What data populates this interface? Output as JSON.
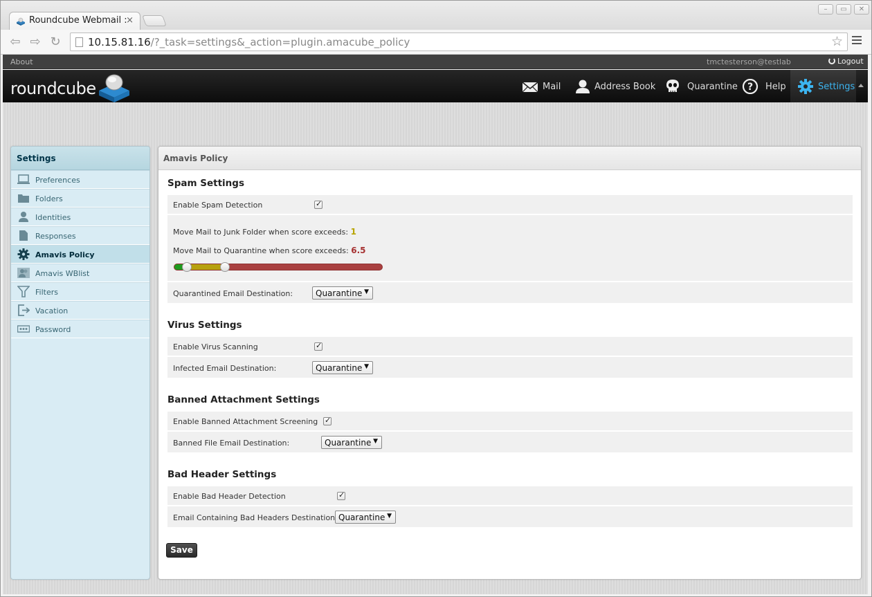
{
  "browser": {
    "tab_title": "Roundcube Webmail :",
    "tab_close": "×",
    "url_host": "10.15.81.16",
    "url_path": "/?_task=settings&_action=plugin.amacube_policy",
    "star": "☆"
  },
  "topline": {
    "about": "About",
    "user": "tmctesterson@testlab",
    "logout": "Logout"
  },
  "logo": {
    "text": "roundcube"
  },
  "nav": {
    "mail": "Mail",
    "addressbook": "Address Book",
    "quarantine": "Quarantine",
    "help": "Help",
    "settings": "Settings"
  },
  "sidebar": {
    "title": "Settings",
    "items": [
      {
        "label": "Preferences",
        "icon": "monitor-icon"
      },
      {
        "label": "Folders",
        "icon": "folder-icon"
      },
      {
        "label": "Identities",
        "icon": "person-icon"
      },
      {
        "label": "Responses",
        "icon": "document-icon"
      },
      {
        "label": "Amavis Policy",
        "icon": "gear-icon"
      },
      {
        "label": "Amavis WBlist",
        "icon": "users-icon"
      },
      {
        "label": "Filters",
        "icon": "filter-icon"
      },
      {
        "label": "Vacation",
        "icon": "exit-icon"
      },
      {
        "label": "Password",
        "icon": "password-icon"
      }
    ]
  },
  "content": {
    "title": "Amavis Policy",
    "spam": {
      "heading": "Spam Settings",
      "enable_label": "Enable Spam Detection",
      "enable_checked": true,
      "junk_label": "Move Mail to Junk Folder when score exceeds:",
      "junk_value": "1",
      "quarantine_label": "Move Mail to Quarantine when score exceeds:",
      "quarantine_value": "6.5",
      "slider": {
        "min": 0,
        "max": 30,
        "junk": 1,
        "quarantine": 6.5
      },
      "dest_label": "Quarantined Email Destination:",
      "dest_value": "Quarantine"
    },
    "virus": {
      "heading": "Virus Settings",
      "enable_label": "Enable Virus Scanning",
      "enable_checked": true,
      "dest_label": "Infected Email Destination:",
      "dest_value": "Quarantine"
    },
    "banned": {
      "heading": "Banned Attachment Settings",
      "enable_label": "Enable Banned Attachment Screening",
      "enable_checked": true,
      "dest_label": "Banned File Email Destination:",
      "dest_value": "Quarantine"
    },
    "badheader": {
      "heading": "Bad Header Settings",
      "enable_label": "Enable Bad Header Detection",
      "enable_checked": true,
      "dest_label": "Email Containing Bad Headers Destination:",
      "dest_value": "Quarantine"
    },
    "save_label": "Save"
  },
  "colors": {
    "accent": "#3cb4f0",
    "slider_green": "#1e9a1e",
    "slider_yellow": "#b7a10e",
    "slider_red": "#a94040"
  }
}
